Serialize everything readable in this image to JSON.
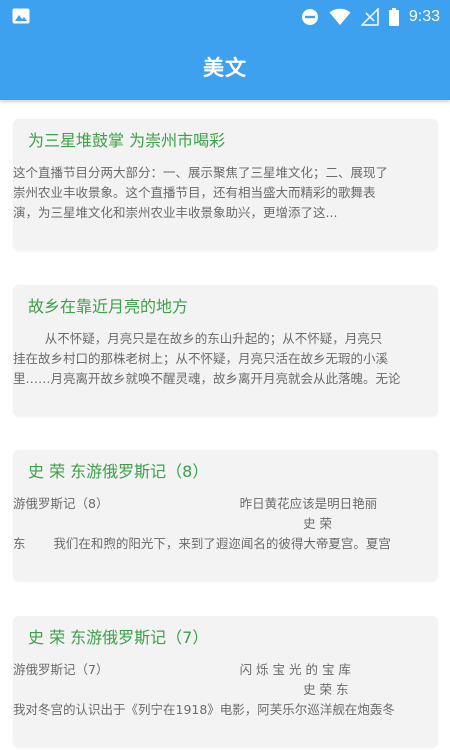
{
  "status_bar": {
    "time": "9:33",
    "left_icon": "image-icon",
    "icons": [
      "dnd-icon",
      "wifi-icon",
      "no-signal-icon",
      "battery-icon"
    ]
  },
  "app_bar": {
    "title": "美文"
  },
  "articles": [
    {
      "title": "为三星堆鼓掌 为崇州市喝彩",
      "excerpt": "这个直播节目分两大部分：一、展示聚焦了三星堆文化；二、展现了\n崇州农业丰收景象。这个直播节目，还有相当盛大而精彩的歌舞表\n演，为三星堆文化和崇州农业丰收景象助兴，更增添了这..."
    },
    {
      "title": "故乡在靠近月亮的地方",
      "excerpt": "        从不怀疑，月亮只是在故乡的东山升起的；从不怀疑，月亮只\n挂在故乡村口的那株老树上；从不怀疑，月亮只活在故乡无瑕的小溪\n里……月亮离开故乡就唤不醒灵魂，故乡离开月亮就会从此落魄。无论"
    },
    {
      "title": "史 荣 东游俄罗斯记（8）",
      "excerpt": "游俄罗斯记（8）                                 昨日黄花应该是明日艳丽\n                                                                         史 荣\n东       我们在和煦的阳光下，来到了遐迩闻名的彼得大帝夏宫。夏宫"
    },
    {
      "title": "史 荣 东游俄罗斯记（7）",
      "excerpt": "游俄罗斯记（7）                                 闪 烁 宝 光 的 宝 库\n                                                                         史 荣 东\n我对冬宫的认识出于《列宁在1918》电影，阿芙乐尔巡洋舰在炮轰冬"
    }
  ],
  "colors": {
    "primary": "#3ea1ef",
    "title_green": "#3ea04a",
    "card_bg": "#f3f3f3",
    "text_gray": "#6b6b6b"
  }
}
